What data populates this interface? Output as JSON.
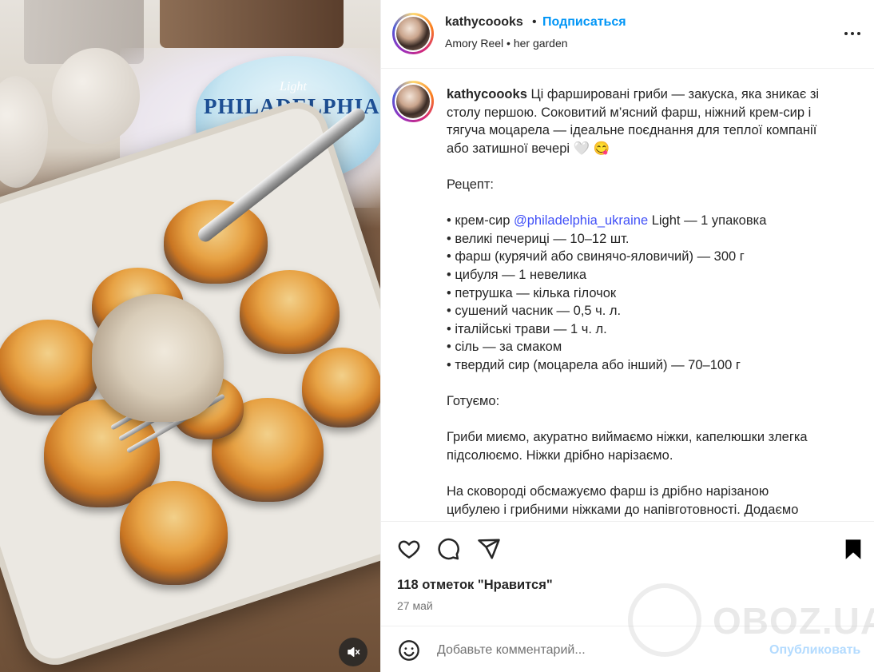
{
  "post": {
    "username": "kathycoooks",
    "dot": "•",
    "follow_label": "Подписаться",
    "audio": "Amory Reel",
    "location": "her garden",
    "audio_separator": "•"
  },
  "media": {
    "tub_brand": "PHILADELPHIA",
    "tub_light": "Light"
  },
  "caption": {
    "username": "kathycoooks",
    "line1": "Ці фаршировані гриби — закуска, яка зникає зі",
    "line2": "столу першою. Соковитий м’ясний фарш, ніжний крем-сир і",
    "line3": "тягуча моцарела — ідеальне поєднання для теплої компанії",
    "line4": "або затишної вечері 🤍 😋",
    "recipe_heading": "Рецепт:",
    "ingredient1_prefix": "• крем-сир ",
    "ingredient1_mention": "@philadelphia_ukraine",
    "ingredient1_suffix": " Light — 1 упаковка",
    "ingredients": [
      "• великі печериці — 10–12 шт.",
      "• фарш (курячий або свинячо-яловичий) — 300 г",
      "• цибуля — 1 невелика",
      "• петрушка — кілька гілочок",
      "• сушений часник — 0,5 ч. л.",
      "• італійські трави — 1 ч. л.",
      "• сіль — за смаком",
      "• твердий сир (моцарела або інший) — 70–100 г"
    ],
    "cook_heading": "Готуємо:",
    "step1_line1": "Гриби миємо, акуратно виймаємо ніжки, капелюшки злегка",
    "step1_line2": "підсолюємо. Ніжки дрібно нарізаємо.",
    "step2_line1": "На сковороді обсмажуємо фарш із дрібно нарізаною",
    "step2_line2": "цибулею і грибними ніжками до напівготовності. Додаємо"
  },
  "actions": {
    "likes": "118 отметок \"Нравится\"",
    "date": "27 май",
    "comment_placeholder": "Добавьте комментарий...",
    "publish_label": "Опубликовать"
  },
  "watermark": {
    "text": "OBOZ.UA"
  },
  "icons": {
    "like": "heart-icon",
    "comment": "comment-icon",
    "share": "share-icon",
    "save": "bookmark-icon",
    "more": "more-icon",
    "emoji": "emoji-icon",
    "mute": "mute-icon"
  },
  "colors": {
    "follow": "#0095f6",
    "mention": "#4150f7",
    "publish_disabled": "#b3dbff",
    "muted_text": "#737373"
  }
}
